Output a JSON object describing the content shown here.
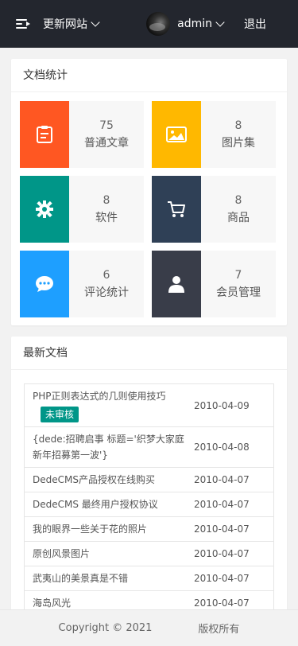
{
  "header": {
    "site_menu_label": "更新网站",
    "username": "admin",
    "logout_label": "退出"
  },
  "stats_card": {
    "title": "文档统计",
    "items": [
      {
        "count": "75",
        "label": "普通文章",
        "icon": "clipboard-icon",
        "color": "#ff5722"
      },
      {
        "count": "8",
        "label": "图片集",
        "icon": "image-icon",
        "color": "#ffb800"
      },
      {
        "count": "8",
        "label": "软件",
        "icon": "gear-icon",
        "color": "#009688"
      },
      {
        "count": "8",
        "label": "商品",
        "icon": "cart-icon",
        "color": "#2f4056"
      },
      {
        "count": "6",
        "label": "评论统计",
        "icon": "chat-icon",
        "color": "#1e9fff"
      },
      {
        "count": "7",
        "label": "会员管理",
        "icon": "user-icon",
        "color": "#393d49"
      }
    ]
  },
  "latest_card": {
    "title": "最新文档",
    "rows": [
      {
        "title": "PHP正则表达式的几则使用技巧",
        "badge": "未审核",
        "date": "2010-04-09"
      },
      {
        "title": "{dede:招聘启事 标题='织梦大家庭新年招募第一波'}",
        "badge": "",
        "date": "2010-04-08"
      },
      {
        "title": "DedeCMS产品授权在线购买",
        "badge": "",
        "date": "2010-04-07"
      },
      {
        "title": "DedeCMS 最终用户授权协议",
        "badge": "",
        "date": "2010-04-07"
      },
      {
        "title": "我的眼界一些关于花的照片",
        "badge": "",
        "date": "2010-04-07"
      },
      {
        "title": "原创风景图片",
        "badge": "",
        "date": "2010-04-07"
      },
      {
        "title": "武夷山的美景真是不错",
        "badge": "",
        "date": "2010-04-07"
      },
      {
        "title": "海岛风光",
        "badge": "",
        "date": "2010-04-07"
      }
    ]
  },
  "footer": {
    "copyright": "Copyright © 2021",
    "rights": "版权所有"
  }
}
